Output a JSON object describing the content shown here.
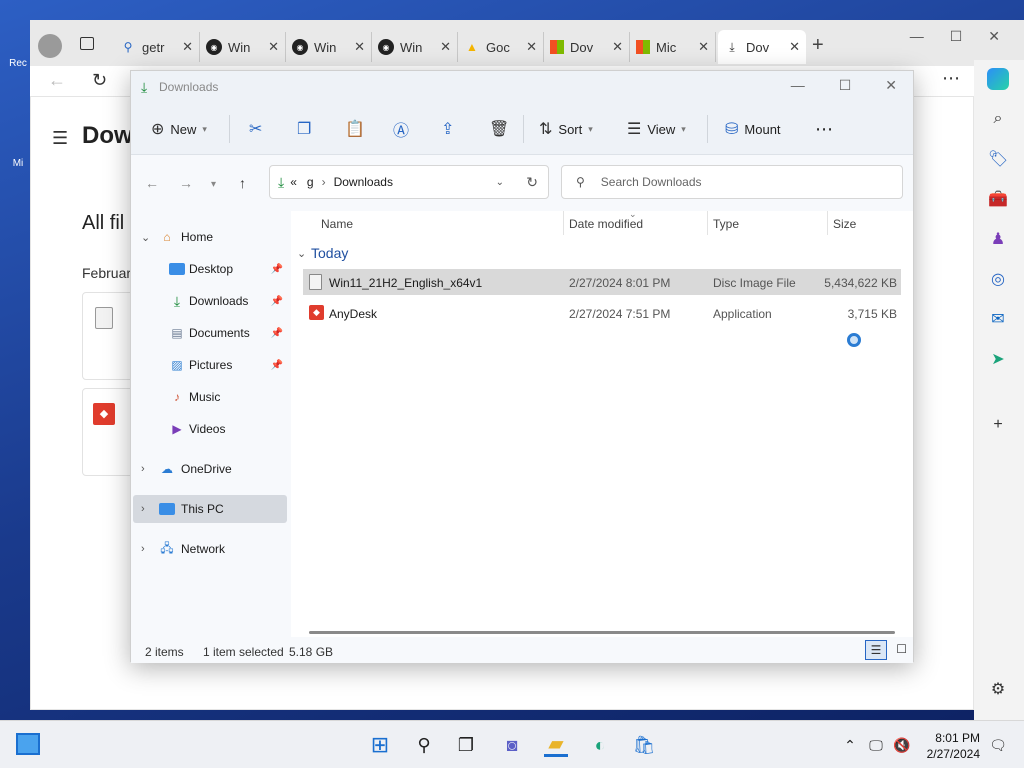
{
  "colors": {
    "accent": "#2766c4",
    "downloads_green": "#1a8a3a",
    "anydesk_red": "#e03c2d",
    "selection": "#d9d9d9"
  },
  "desktop": {
    "icons": [
      {
        "label": "Rec"
      },
      {
        "label": "Mi"
      }
    ]
  },
  "browser": {
    "tabs": [
      {
        "label": "getr",
        "icon": "search-icon"
      },
      {
        "label": "Win",
        "icon": "disc-icon"
      },
      {
        "label": "Win",
        "icon": "disc-icon"
      },
      {
        "label": "Win",
        "icon": "disc-icon"
      },
      {
        "label": "Goc",
        "icon": "google-drive-icon"
      },
      {
        "label": "Dov",
        "icon": "microsoft-icon"
      },
      {
        "label": "Mic",
        "icon": "microsoft-icon"
      },
      {
        "label": "Dov",
        "icon": "download-icon"
      }
    ],
    "page": {
      "title": "Dow",
      "section": "All fil",
      "date_group": "Februar"
    }
  },
  "explorer": {
    "title": "Downloads",
    "toolbar": {
      "new": "New",
      "sort": "Sort",
      "view": "View",
      "mount": "Mount"
    },
    "address": {
      "prefix": "«",
      "drive": "g",
      "sep": "›",
      "folder": "Downloads"
    },
    "search_placeholder": "Search Downloads",
    "nav": {
      "home": "Home",
      "desktop": "Desktop",
      "downloads": "Downloads",
      "documents": "Documents",
      "pictures": "Pictures",
      "music": "Music",
      "videos": "Videos",
      "onedrive": "OneDrive",
      "thispc": "This PC",
      "network": "Network"
    },
    "columns": {
      "name": "Name",
      "date": "Date modified",
      "type": "Type",
      "size": "Size"
    },
    "group": "Today",
    "files": [
      {
        "name": "Win11_21H2_English_x64v1",
        "date": "2/27/2024 8:01 PM",
        "type": "Disc Image File",
        "size": "5,434,622 KB",
        "selected": true
      },
      {
        "name": "AnyDesk",
        "date": "2/27/2024 7:51 PM",
        "type": "Application",
        "size": "3,715 KB",
        "selected": false
      }
    ],
    "status": {
      "count": "2 items",
      "selected": "1 item selected",
      "size": "5.18 GB"
    }
  },
  "taskbar": {
    "time": "8:01 PM",
    "date": "2/27/2024"
  }
}
